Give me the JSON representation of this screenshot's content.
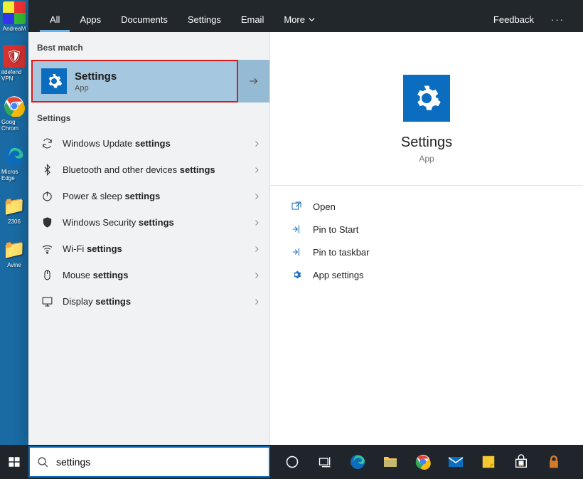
{
  "desktop": {
    "icons": [
      {
        "label": "AndreaM",
        "bg": "",
        "char": ""
      },
      {
        "label": "itdefend VPN",
        "bg": "#d63030",
        "char": "🛡"
      },
      {
        "label": "Goog Chrom",
        "bg": "",
        "char": ""
      },
      {
        "label": "Micros Edge",
        "bg": "",
        "char": ""
      },
      {
        "label": "2306",
        "bg": "#f1d26a",
        "char": "📁"
      },
      {
        "label": "Avine",
        "bg": "#f1d26a",
        "char": "📁"
      }
    ]
  },
  "topBar": {
    "tabs": [
      {
        "label": "All",
        "active": true
      },
      {
        "label": "Apps",
        "active": false
      },
      {
        "label": "Documents",
        "active": false
      },
      {
        "label": "Settings",
        "active": false
      },
      {
        "label": "Email",
        "active": false
      },
      {
        "label": "More",
        "active": false,
        "dropdown": true
      }
    ],
    "feedback": "Feedback"
  },
  "left": {
    "bestMatchLabel": "Best match",
    "bestMatch": {
      "title": "Settings",
      "subtitle": "App"
    },
    "settingsLabel": "Settings",
    "items": [
      {
        "icon": "refresh",
        "pre": "Windows Update ",
        "bold": "settings"
      },
      {
        "icon": "bluetooth",
        "pre": "Bluetooth and other devices ",
        "bold": "settings"
      },
      {
        "icon": "power",
        "pre": "Power & sleep ",
        "bold": "settings"
      },
      {
        "icon": "shield",
        "pre": "Windows Security ",
        "bold": "settings"
      },
      {
        "icon": "wifi",
        "pre": "Wi-Fi ",
        "bold": "settings"
      },
      {
        "icon": "mouse",
        "pre": "Mouse ",
        "bold": "settings"
      },
      {
        "icon": "display",
        "pre": "Display ",
        "bold": "settings"
      }
    ]
  },
  "right": {
    "title": "Settings",
    "subtitle": "App",
    "actions": [
      {
        "icon": "open",
        "label": "Open"
      },
      {
        "icon": "pin-start",
        "label": "Pin to Start"
      },
      {
        "icon": "pin-taskbar",
        "label": "Pin to taskbar"
      },
      {
        "icon": "gear",
        "label": "App settings"
      }
    ]
  },
  "search": {
    "value": "settings"
  }
}
